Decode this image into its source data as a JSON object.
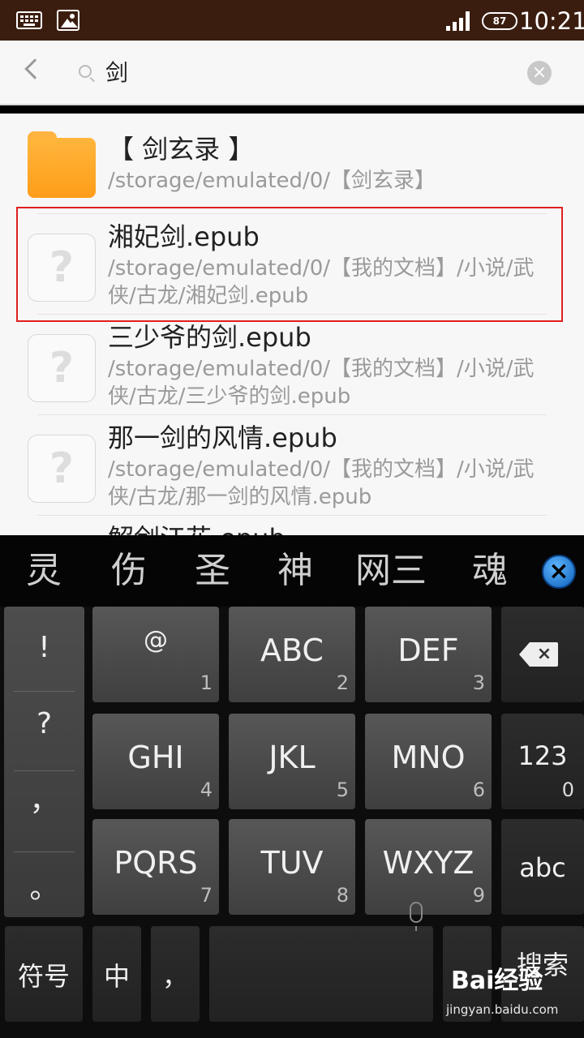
{
  "status_bar": {
    "time": "10:21",
    "battery": "87"
  },
  "search": {
    "query": "剑"
  },
  "results": [
    {
      "title": "【 剑玄录 】",
      "path": "/storage/emulated/0/【剑玄录】",
      "type": "folder"
    },
    {
      "title": "湘妃剑.epub",
      "path": "/storage/emulated/0/【我的文档】/小说/武侠/古龙/湘妃剑.epub",
      "type": "unknown-file"
    },
    {
      "title": "三少爷的剑.epub",
      "path": "/storage/emulated/0/【我的文档】/小说/武侠/古龙/三少爷的剑.epub",
      "type": "unknown-file"
    },
    {
      "title": "那一剑的风情.epub",
      "path": "/storage/emulated/0/【我的文档】/小说/武侠/古龙/那一剑的风情.epub",
      "type": "unknown-file"
    },
    {
      "title": "解剑江花.epub",
      "type": "unknown-file"
    }
  ],
  "keyboard": {
    "candidates": [
      "灵",
      "伤",
      "圣",
      "神",
      "网三",
      "魂"
    ],
    "punct": [
      "!",
      "?",
      "，",
      "。"
    ],
    "keys": [
      {
        "label": "@",
        "num": "1"
      },
      {
        "label": "ABC",
        "num": "2"
      },
      {
        "label": "DEF",
        "num": "3"
      },
      {
        "label": "GHI",
        "num": "4"
      },
      {
        "label": "JKL",
        "num": "5"
      },
      {
        "label": "MNO",
        "num": "6"
      },
      {
        "label": "PQRS",
        "num": "7"
      },
      {
        "label": "TUV",
        "num": "8"
      },
      {
        "label": "WXYZ",
        "num": "9"
      }
    ],
    "num_key_label": "123",
    "num_key_sub": "0",
    "abc_key": "abc",
    "symbol_key": "符号",
    "cn_key": "中",
    "comma_key": "，",
    "search_key": "搜索"
  },
  "watermark": {
    "baidu": "Bai经验",
    "site": "jingyan.baidu.com"
  }
}
